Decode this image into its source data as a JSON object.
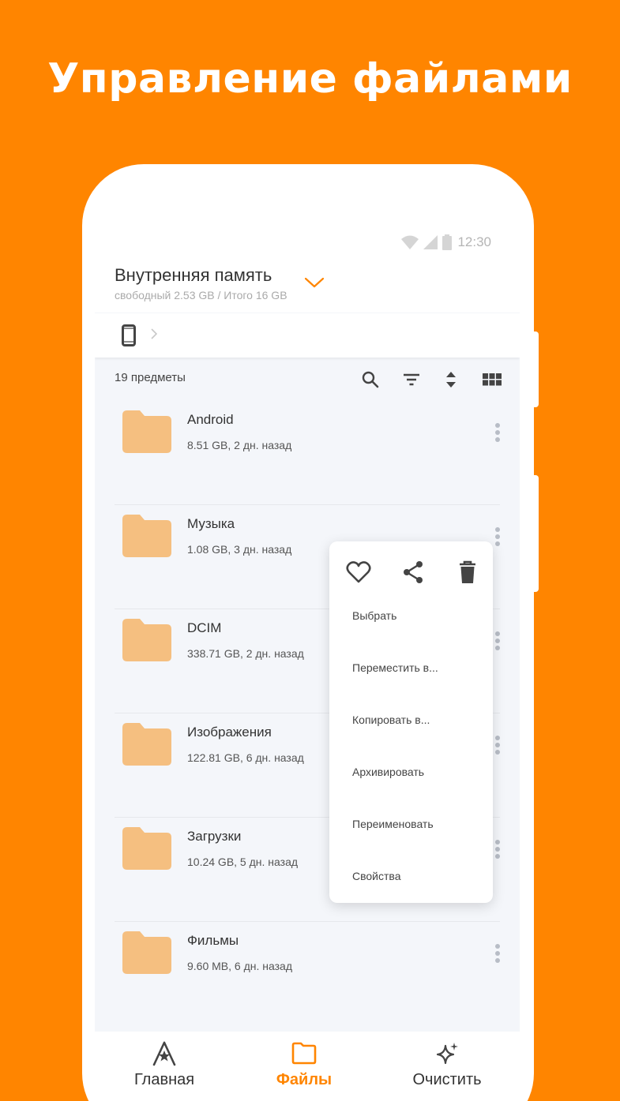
{
  "promo": {
    "title": "Управление файлами"
  },
  "status_bar": {
    "time": "12:30"
  },
  "header": {
    "title": "Внутренняя память",
    "subtitle": "свободный 2.53 GB / Итого 16 GB"
  },
  "toolbar": {
    "item_count": "19 предметы"
  },
  "files": [
    {
      "name": "Android",
      "meta": "8.51 GB, 2 дн. назад"
    },
    {
      "name": "Музыка",
      "meta": "1.08 GB, 3 дн. назад"
    },
    {
      "name": "DCIM",
      "meta": "338.71 GB, 2 дн. назад"
    },
    {
      "name": "Изображения",
      "meta": "122.81 GB, 6 дн. назад"
    },
    {
      "name": "Загрузки",
      "meta": "10.24 GB, 5 дн. назад"
    },
    {
      "name": "Фильмы",
      "meta": "9.60 MB, 6 дн. назад"
    }
  ],
  "context_menu": {
    "items": [
      "Выбрать",
      "Переместить в...",
      "Копировать в...",
      "Архивировать",
      "Переименовать",
      "Свойства"
    ]
  },
  "bottom_nav": {
    "items": [
      {
        "label": "Главная",
        "icon": "home-star-icon"
      },
      {
        "label": "Файлы",
        "icon": "folder-icon"
      },
      {
        "label": "Очистить",
        "icon": "sparkle-icon"
      }
    ],
    "active": "Файлы"
  },
  "colors": {
    "accent": "#FF8500",
    "folder": "#F5BF80",
    "background": "#F4F6FA"
  }
}
